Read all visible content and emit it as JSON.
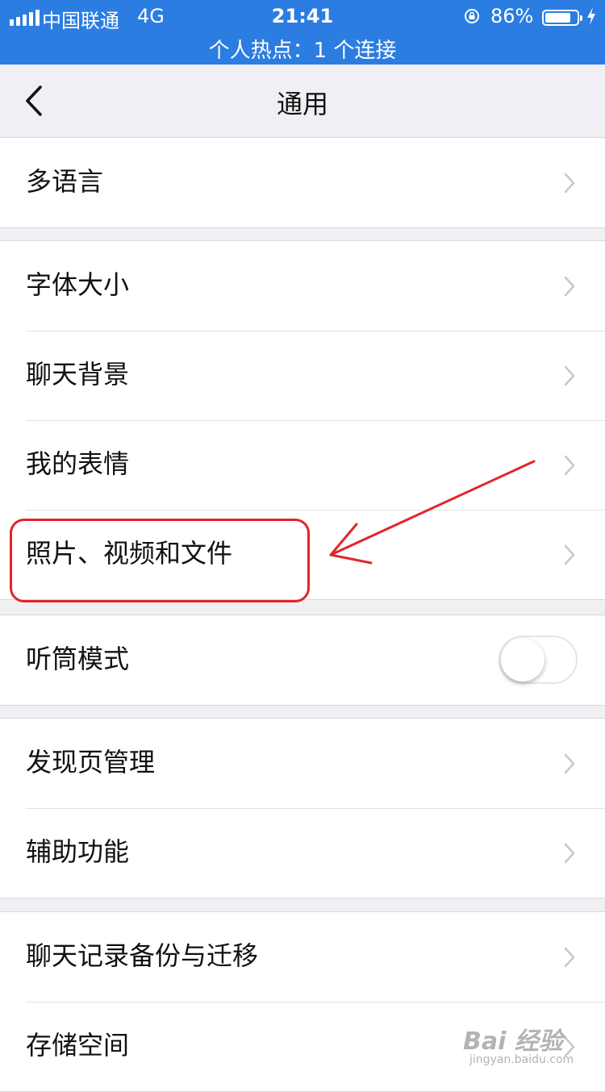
{
  "status_bar": {
    "carrier": "中国联通",
    "network": "4G",
    "time": "21:41",
    "battery_percent": "86%",
    "battery_level": 0.86,
    "hotspot": "个人热点：1 个连接",
    "color": "#2b7de1"
  },
  "nav": {
    "title": "通用",
    "back_icon": "chevron-left-icon"
  },
  "groups": [
    {
      "items": [
        {
          "label": "多语言",
          "accessory": "chevron"
        }
      ]
    },
    {
      "items": [
        {
          "label": "字体大小",
          "accessory": "chevron"
        },
        {
          "label": "聊天背景",
          "accessory": "chevron"
        },
        {
          "label": "我的表情",
          "accessory": "chevron"
        },
        {
          "label": "照片、视频和文件",
          "accessory": "chevron",
          "highlighted": true
        }
      ]
    },
    {
      "items": [
        {
          "label": "听筒模式",
          "accessory": "toggle",
          "toggle_on": false
        }
      ]
    },
    {
      "items": [
        {
          "label": "发现页管理",
          "accessory": "chevron"
        },
        {
          "label": "辅助功能",
          "accessory": "chevron"
        }
      ]
    },
    {
      "items": [
        {
          "label": "聊天记录备份与迁移",
          "accessory": "chevron"
        },
        {
          "label": "存储空间",
          "accessory": "chevron"
        }
      ]
    }
  ],
  "annotation": {
    "color": "#e0262d",
    "target": "照片、视频和文件"
  },
  "watermark": {
    "logo": "Bai 经验",
    "sub": "jingyan.baidu.com"
  }
}
